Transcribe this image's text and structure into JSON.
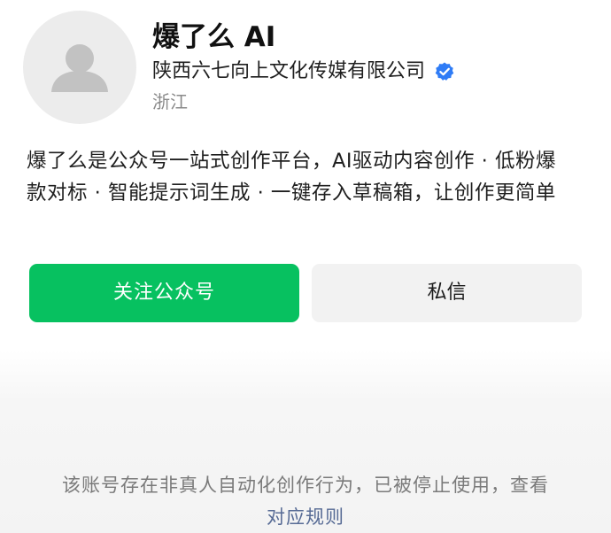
{
  "profile": {
    "name": "爆了么 AI",
    "company": "陕西六七向上文化传媒有限公司",
    "region": "浙江",
    "description": "爆了么是公众号一站式创作平台，AI驱动内容创作 · 低粉爆款对标 · 智能提示词生成 · 一键存入草稿箱，让创作更简单"
  },
  "actions": {
    "follow_label": "关注公众号",
    "message_label": "私信"
  },
  "notice": {
    "text_before": "该账号存在非真人自动化创作行为，已被停止使用，查看",
    "link_label": "对应规则"
  },
  "colors": {
    "primary_green": "#07c160",
    "verified_blue": "#2f7cf6",
    "link_blue": "#576b95"
  },
  "icons": {
    "avatar": "default-person-avatar",
    "verified": "verified-badge-icon"
  }
}
